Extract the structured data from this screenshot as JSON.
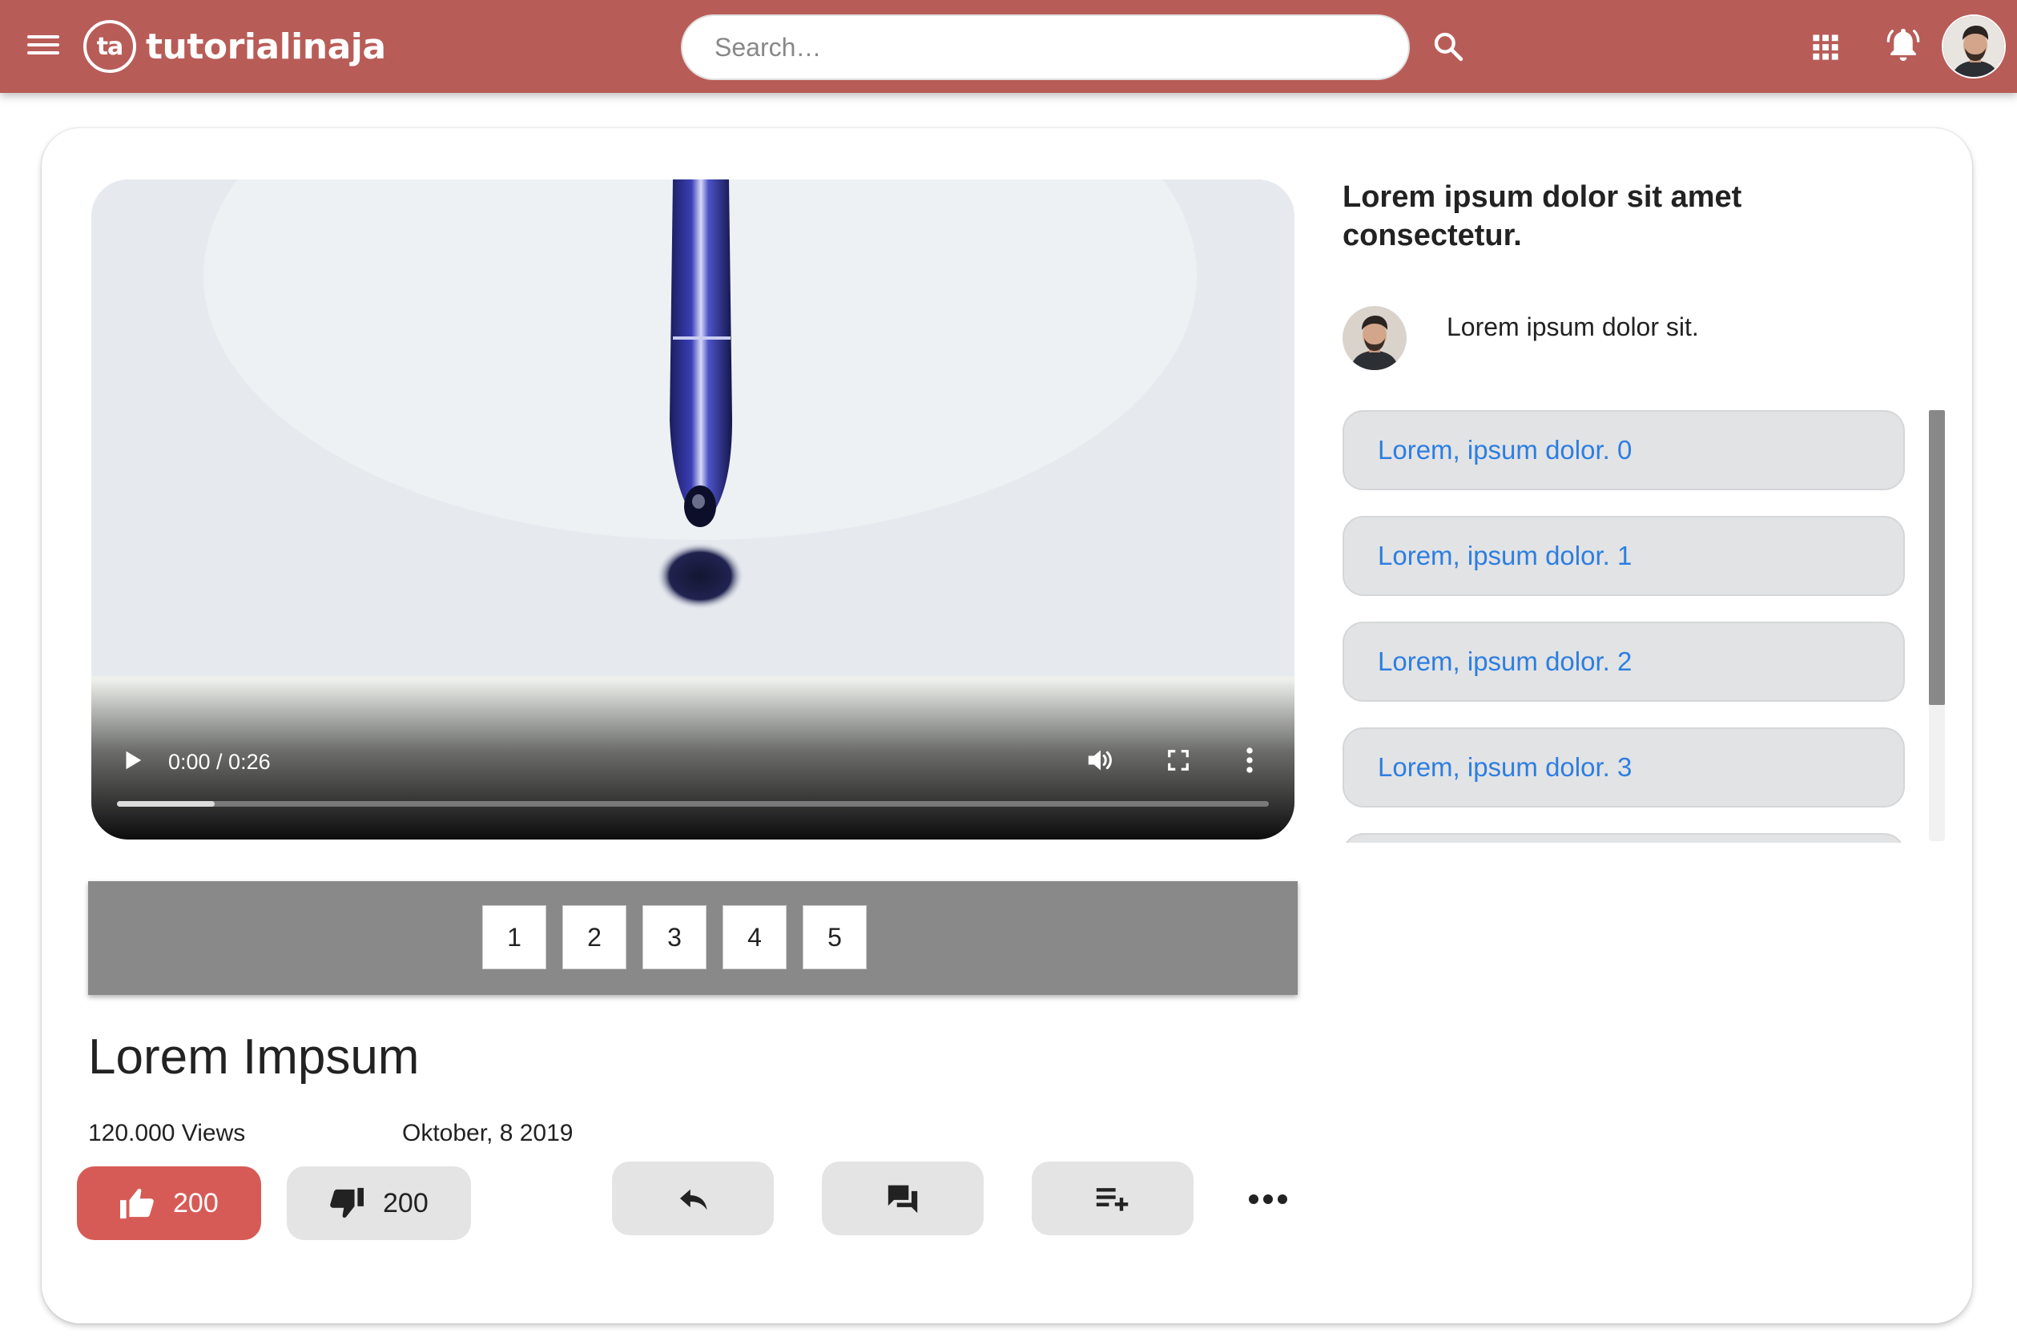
{
  "header": {
    "logo_badge": "ta",
    "logo_text": "tutorialinaja",
    "search_placeholder": "Search…",
    "icons": [
      "menu-icon",
      "search-icon",
      "apps-grid-icon",
      "bell-icon",
      "avatar"
    ]
  },
  "video": {
    "time_display": "0:00 / 0:26",
    "progress_fraction": 0.085
  },
  "pagination": {
    "pages": [
      "1",
      "2",
      "3",
      "4",
      "5"
    ]
  },
  "details": {
    "title": "Lorem Impsum",
    "views": "120.000 Views",
    "date": "Oktober, 8 2019",
    "likes": "200",
    "dislikes": "200"
  },
  "sidebar": {
    "title": "Lorem ipsum dolor sit amet consectetur.",
    "author": "Lorem ipsum dolor sit.",
    "items": [
      "Lorem, ipsum dolor. 0",
      "Lorem, ipsum dolor. 1",
      "Lorem, ipsum dolor. 2",
      "Lorem, ipsum dolor. 3",
      ""
    ]
  },
  "colors": {
    "header_bg": "#b85c58",
    "like_bg": "#d65b57",
    "link_blue": "#2d7ee0",
    "pager_bg": "#898989"
  }
}
